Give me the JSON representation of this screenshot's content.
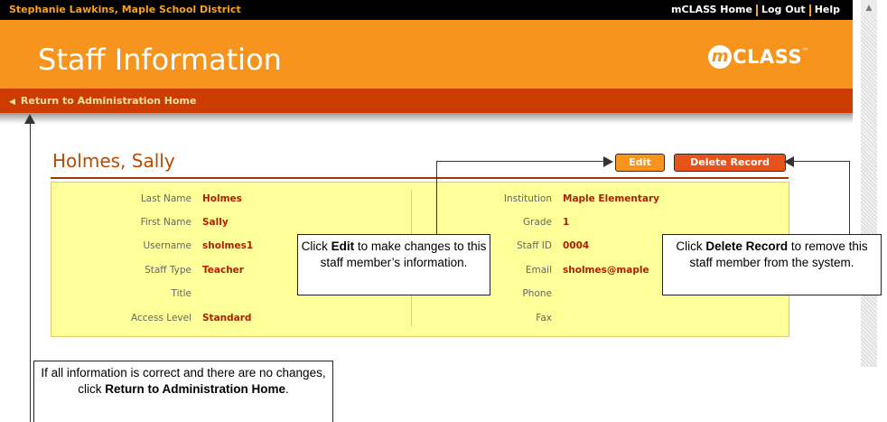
{
  "topbar": {
    "user_label": "Stephanie Lawkins, Maple School District",
    "links": [
      "mCLASS Home",
      "Log Out",
      "Help"
    ]
  },
  "header": {
    "title": "Staff Information",
    "logo_m": "m",
    "logo_text": "CLASS",
    "logo_tm": "™"
  },
  "nav": {
    "back_icon": "left-triangle-icon",
    "back_label": "Return to Administration Home"
  },
  "record": {
    "name": "Holmes, Sally",
    "edit_label": "Edit",
    "delete_label": "Delete Record",
    "left_fields": [
      {
        "label": "Last Name",
        "value": "Holmes"
      },
      {
        "label": "First Name",
        "value": "Sally"
      },
      {
        "label": "Username",
        "value": "sholmes1"
      },
      {
        "label": "Staff Type",
        "value": "Teacher"
      },
      {
        "label": "Title",
        "value": ""
      },
      {
        "label": "Access Level",
        "value": "Standard"
      }
    ],
    "right_fields": [
      {
        "label": "Institution",
        "value": "Maple Elementary"
      },
      {
        "label": "Grade",
        "value": "1"
      },
      {
        "label": "Staff ID",
        "value": "0004"
      },
      {
        "label": "Email",
        "value": "sholmes@maple"
      },
      {
        "label": "Phone",
        "value": ""
      },
      {
        "label": "Fax",
        "value": ""
      }
    ]
  },
  "callouts": {
    "edit": {
      "pre": "Click ",
      "bold": "Edit",
      "post": " to make changes to this staff member’s information."
    },
    "delete": {
      "pre": "Click ",
      "bold": "Delete Record",
      "post": "  to remove this staff member from the system."
    },
    "return": {
      "pre": "If all information is correct and there are no changes, click ",
      "bold": "Return to Administration Home",
      "post": "."
    }
  },
  "colors": {
    "header_orange": "#f7941d",
    "nav_red": "#cc3b00",
    "panel_yellow": "#ffff99",
    "value_red": "#b01e00"
  }
}
